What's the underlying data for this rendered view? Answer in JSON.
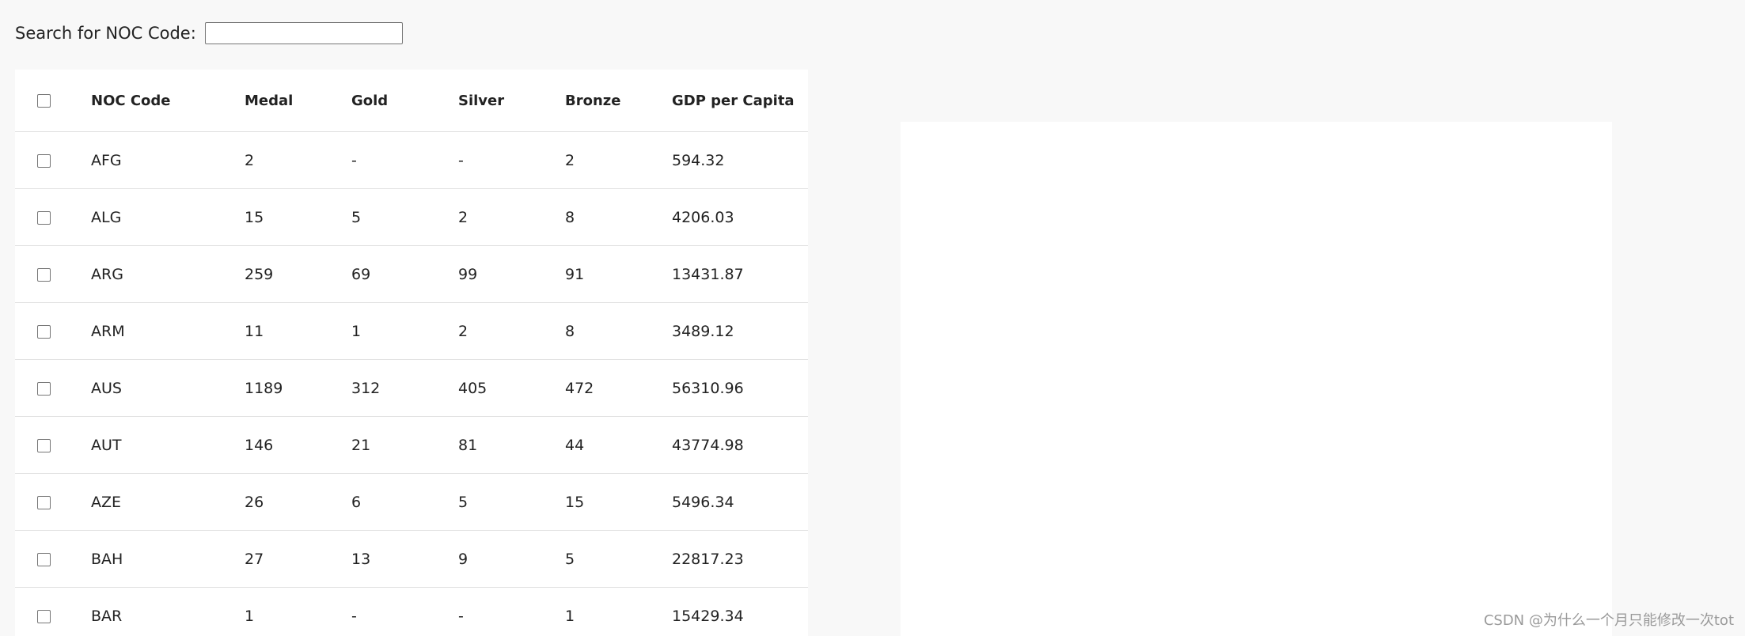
{
  "search": {
    "label": "Search for NOC Code:",
    "value": "",
    "placeholder": ""
  },
  "table": {
    "headers": [
      "NOC Code",
      "Medal",
      "Gold",
      "Silver",
      "Bronze",
      "GDP per Capita"
    ],
    "rows": [
      [
        "AFG",
        "2",
        "-",
        "-",
        "2",
        "594.32"
      ],
      [
        "ALG",
        "15",
        "5",
        "2",
        "8",
        "4206.03"
      ],
      [
        "ARG",
        "259",
        "69",
        "99",
        "91",
        "13431.87"
      ],
      [
        "ARM",
        "11",
        "1",
        "2",
        "8",
        "3489.12"
      ],
      [
        "AUS",
        "1189",
        "312",
        "405",
        "472",
        "56310.96"
      ],
      [
        "AUT",
        "146",
        "21",
        "81",
        "44",
        "43774.98"
      ],
      [
        "AZE",
        "26",
        "6",
        "5",
        "15",
        "5496.34"
      ],
      [
        "BAH",
        "27",
        "13",
        "9",
        "5",
        "22817.23"
      ],
      [
        "BAR",
        "1",
        "-",
        "-",
        "1",
        "15429.34"
      ]
    ]
  },
  "watermark": "CSDN @为什么一个月只能修改一次tot"
}
